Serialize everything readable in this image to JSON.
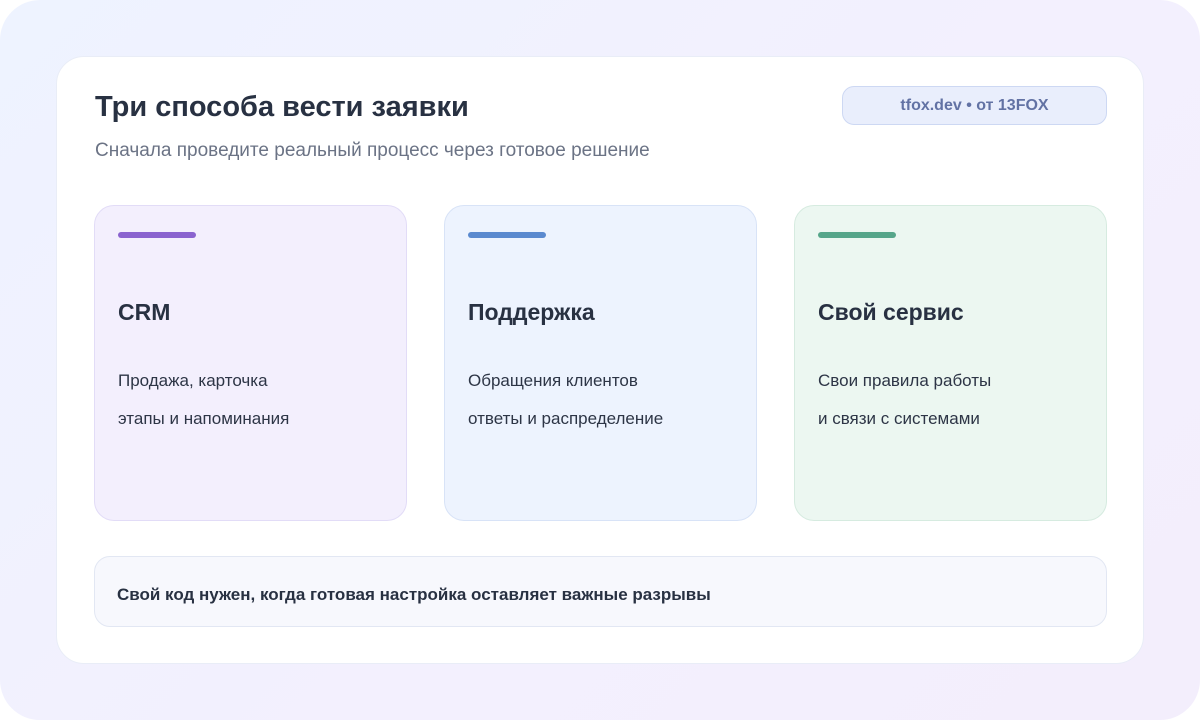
{
  "header": {
    "title": "Три способа вести заявки",
    "subtitle": "Сначала проведите реальный процесс через готовое решение"
  },
  "cards": [
    {
      "title": "CRM",
      "line1": "Продажа, карточка",
      "line2": "этапы и напоминания",
      "accent_color": "#8a63cf"
    },
    {
      "title": "Поддержка",
      "line1": "Обращения клиентов",
      "line2": "ответы и распределение",
      "accent_color": "#5a89cf"
    },
    {
      "title": "Свой сервис",
      "line1": "Свои правила работы",
      "line2": "и связи с системами",
      "accent_color": "#56a68a"
    }
  ],
  "note": {
    "text": "Свой код нужен, когда готовая настройка оставляет важные разрывы"
  },
  "badge": {
    "text": "tfox.dev • от 13FOX"
  }
}
